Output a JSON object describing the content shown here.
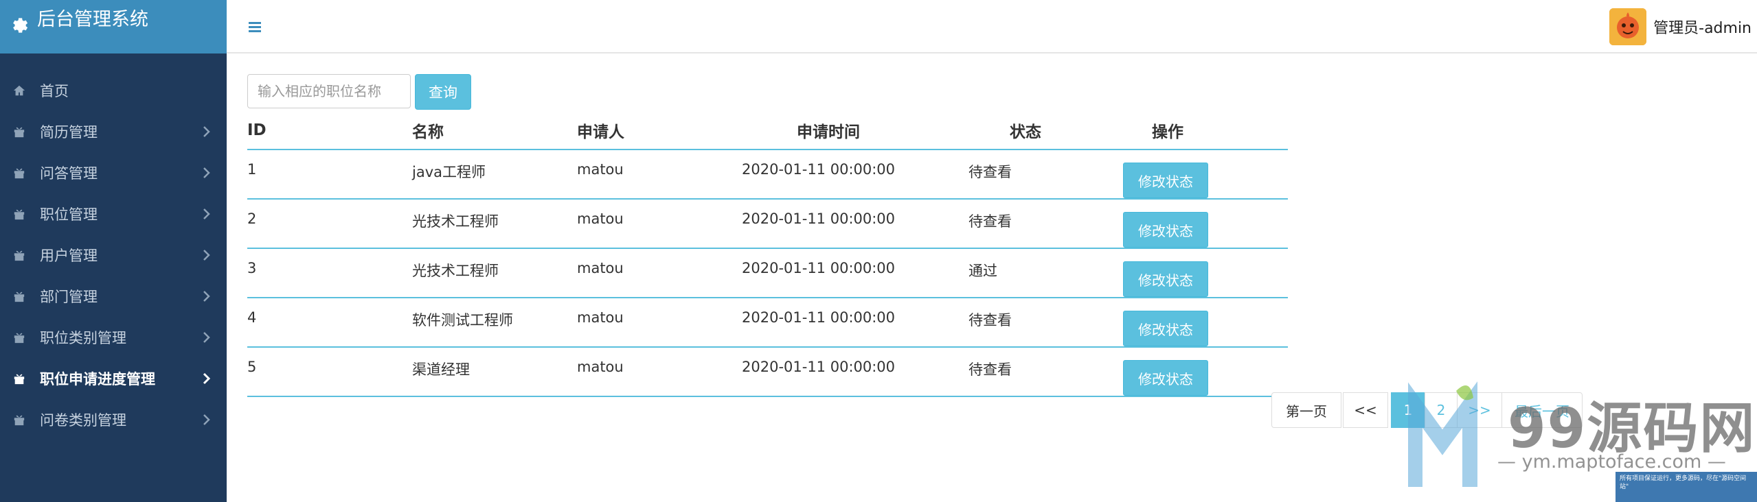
{
  "brand": {
    "title": "后台管理系统",
    "icon": "gear-icon"
  },
  "sidebar": {
    "items": [
      {
        "label": "首页",
        "icon": "home-icon",
        "has_arrow": false
      },
      {
        "label": "简历管理",
        "icon": "gift-icon",
        "has_arrow": true
      },
      {
        "label": "问答管理",
        "icon": "gift-icon",
        "has_arrow": true
      },
      {
        "label": "职位管理",
        "icon": "gift-icon",
        "has_arrow": true
      },
      {
        "label": "用户管理",
        "icon": "gift-icon",
        "has_arrow": true
      },
      {
        "label": "部门管理",
        "icon": "gift-icon",
        "has_arrow": true
      },
      {
        "label": "职位类别管理",
        "icon": "gift-icon",
        "has_arrow": true
      },
      {
        "label": "职位申请进度管理",
        "icon": "gift-icon",
        "has_arrow": true,
        "active": true
      },
      {
        "label": "问卷类别管理",
        "icon": "gift-icon",
        "has_arrow": true
      }
    ]
  },
  "header": {
    "user_name": "管理员-admin"
  },
  "search": {
    "placeholder": "输入相应的职位名称",
    "button_label": "查询"
  },
  "table": {
    "columns": [
      "ID",
      "名称",
      "申请人",
      "申请时间",
      "状态",
      "操作"
    ],
    "rows": [
      {
        "id": "1",
        "name": "java工程师",
        "applicant": "matou",
        "time": "2020-01-11 00:00:00",
        "status": "待查看",
        "action": "修改状态"
      },
      {
        "id": "2",
        "name": "光技术工程师",
        "applicant": "matou",
        "time": "2020-01-11 00:00:00",
        "status": "待查看",
        "action": "修改状态"
      },
      {
        "id": "3",
        "name": "光技术工程师",
        "applicant": "matou",
        "time": "2020-01-11 00:00:00",
        "status": "通过",
        "action": "修改状态"
      },
      {
        "id": "4",
        "name": "软件测试工程师",
        "applicant": "matou",
        "time": "2020-01-11 00:00:00",
        "status": "待查看",
        "action": "修改状态"
      },
      {
        "id": "5",
        "name": "渠道经理",
        "applicant": "matou",
        "time": "2020-01-11 00:00:00",
        "status": "待查看",
        "action": "修改状态"
      }
    ]
  },
  "pagination": {
    "first": "第一页",
    "prev": "<<",
    "pages": [
      "1",
      "2"
    ],
    "next": ">>",
    "last": "最后一页"
  },
  "watermark": {
    "title": "99源码网",
    "url": "ym.maptoface.com",
    "note": "所有项目保证运行，更多源码，尽在\"源码空间站\""
  },
  "colors": {
    "sidebar_bg": "#1f3a5c",
    "brand_bg": "#3c8dbc",
    "accent": "#5bc0de"
  }
}
